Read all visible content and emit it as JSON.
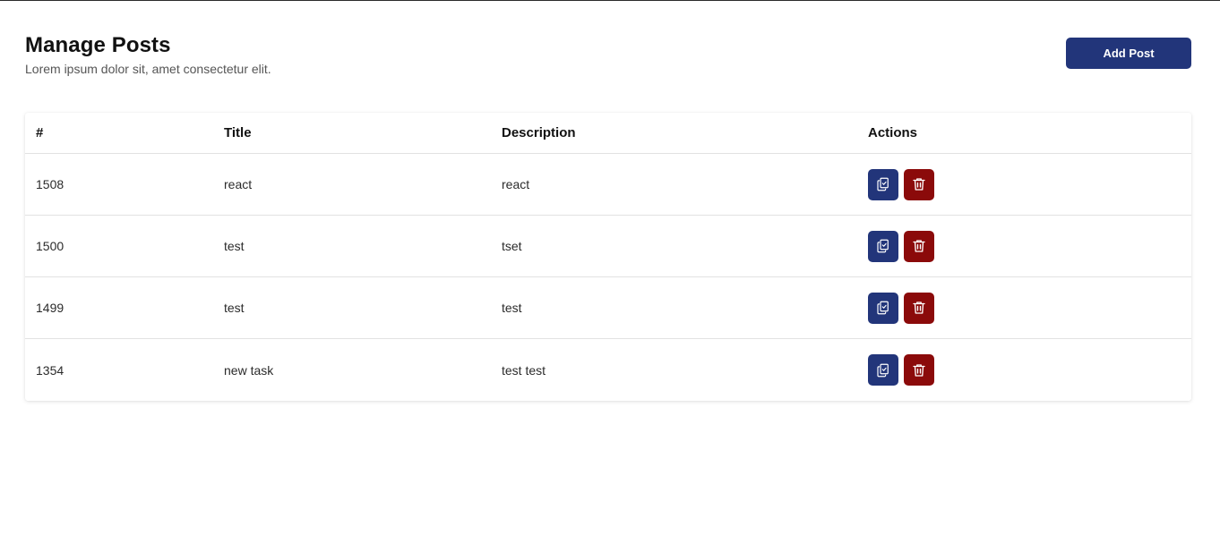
{
  "header": {
    "title": "Manage Posts",
    "subtitle": "Lorem ipsum dolor sit, amet consectetur elit.",
    "add_button_label": "Add Post"
  },
  "table": {
    "columns": [
      "#",
      "Title",
      "Description",
      "Actions"
    ],
    "rows": [
      {
        "id": "1508",
        "title": "react",
        "description": "react"
      },
      {
        "id": "1500",
        "title": "test",
        "description": "tset"
      },
      {
        "id": "1499",
        "title": "test",
        "description": "test"
      },
      {
        "id": "1354",
        "title": "new task",
        "description": "test test"
      }
    ],
    "row_actions": [
      {
        "name": "clipboard-check-icon",
        "color": "#22357a"
      },
      {
        "name": "trash-icon",
        "color": "#8b0a0a"
      }
    ]
  },
  "colors": {
    "primary": "#22357a",
    "danger": "#8b0a0a",
    "subtitle_text": "#555555"
  }
}
